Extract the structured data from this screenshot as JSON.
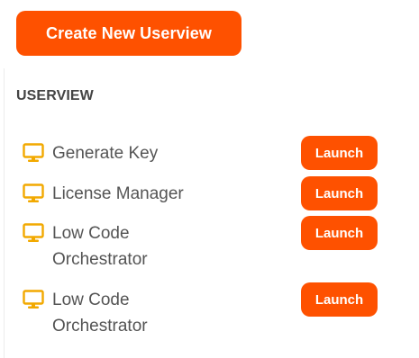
{
  "create_button": {
    "label": "Create New Userview"
  },
  "section": {
    "heading": "USERVIEW"
  },
  "userviews": [
    {
      "name": "Generate Key",
      "action_label": "Launch",
      "icon": "monitor-icon"
    },
    {
      "name": "License Manager",
      "action_label": "Launch",
      "icon": "monitor-icon"
    },
    {
      "name": "Low Code Orchestrator",
      "action_label": "Launch",
      "icon": "monitor-icon"
    },
    {
      "name": "Low Code Orchestrator",
      "action_label": "Launch",
      "icon": "monitor-icon"
    }
  ],
  "colors": {
    "accent": "#fe5100",
    "icon": "#f2a900",
    "text": "#545454",
    "heading": "#444444"
  }
}
